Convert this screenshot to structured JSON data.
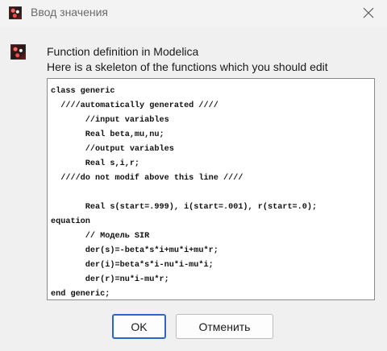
{
  "window": {
    "title": "Ввод значения"
  },
  "icons": {
    "app": "scilab-app-icon",
    "message": "scilab-app-icon",
    "close": "close-icon"
  },
  "message": {
    "heading": "Function definition in Modelica",
    "subheading": "Here is a skeleton of the functions which you should edit"
  },
  "editor": {
    "code": "class generic\n  ////automatically generated ////\n       //input variables\n       Real beta,mu,nu;\n       //output variables\n       Real s,i,r;\n  ////do not modif above this line ////\n\n       Real s(start=.999), i(start=.001), r(start=.0);\nequation\n       // Модель SIR\n       der(s)=-beta*s*i+mu*i+mu*r;\n       der(i)=beta*s*i-nu*i-mu*i;\n       der(r)=nu*i-mu*r;\nend generic;"
  },
  "buttons": {
    "ok": "OK",
    "cancel": "Отменить"
  },
  "colors": {
    "background": "#f0f0f0",
    "accent_focus": "#2a66c6",
    "editor_bg": "#ffffff"
  }
}
